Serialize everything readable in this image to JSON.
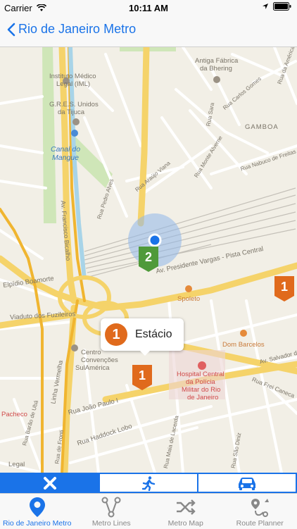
{
  "status_bar": {
    "carrier": "Carrier",
    "time": "10:11 AM"
  },
  "nav": {
    "title": "Rio de Janeiro Metro"
  },
  "map": {
    "labels": [
      "Instituto Médico",
      "Legal (IML)",
      "G.R.E.S. Unidos",
      "da Tijuca",
      "Canal do",
      "Mangue",
      "Antiga Fábrica",
      "da Bhering",
      "GAMBOA",
      "Rua Sara",
      "Rua Carlos Gomes",
      "Rua da América",
      "Rua Monte Alverne",
      "Rua Nabuco de Freitas",
      "Rua Araújo Viana",
      "Rua Pedro Alves",
      "Av. Francisco Bicalho",
      "Av. Presidente Vargas - Pista Central",
      "Elpídio Boamorte",
      "Viaduto dos Fuzileiros",
      "Spoleto",
      "Dom Barcelos",
      "Centro",
      "Convenções",
      "SulAmérica",
      "Hospital Central",
      "da Polícia",
      "Militar do Rio",
      "de Janeiro",
      "Av. Salvador de Sá",
      "Rua Frei Caneca",
      "Linha Vermelha",
      "Rua João Paulo I",
      "Rua Haddock Lobo",
      "Rua Barão de Ubá",
      "Pacheco",
      "Legal",
      "Rua de Fronti",
      "Rua Maia de Lacerda",
      "Rua São Diniz"
    ],
    "markers": [
      {
        "number": "2",
        "color": "#4f9a3a"
      },
      {
        "number": "1",
        "color": "#e06a1c"
      },
      {
        "number": "1",
        "color": "#e06a1c"
      }
    ],
    "callout": {
      "number": "1",
      "station": "Estácio"
    }
  },
  "mode_selector": {
    "options": [
      "close",
      "walking",
      "driving"
    ],
    "selected": "close"
  },
  "tabs": [
    {
      "label": "Rio de Janeiro Metro",
      "icon": "map-pin-icon",
      "active": true
    },
    {
      "label": "Metro Lines",
      "icon": "lines-icon",
      "active": false
    },
    {
      "label": "Metro Map",
      "icon": "shuffle-icon",
      "active": false
    },
    {
      "label": "Route Planner",
      "icon": "route-icon",
      "active": false
    }
  ],
  "colors": {
    "accent": "#1a73e8",
    "line1": "#e06a1c",
    "line2": "#4f9a3a",
    "highway": "#f5c93b"
  }
}
